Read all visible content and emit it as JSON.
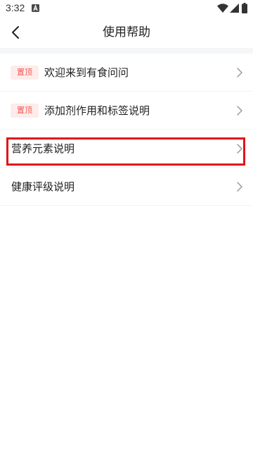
{
  "status_bar": {
    "time": "3:32"
  },
  "header": {
    "title": "使用帮助"
  },
  "help_items": [
    {
      "badge": "置顶",
      "label": "欢迎来到有食问问"
    },
    {
      "badge": "置顶",
      "label": "添加剂作用和标签说明"
    },
    {
      "badge": "",
      "label": "营养元素说明"
    },
    {
      "badge": "",
      "label": "健康评级说明"
    }
  ],
  "colors": {
    "badge_text": "#ef5a55",
    "badge_bg": "#fdeceb",
    "highlight": "#e0141e",
    "separator_band": "#f5f6f8"
  }
}
